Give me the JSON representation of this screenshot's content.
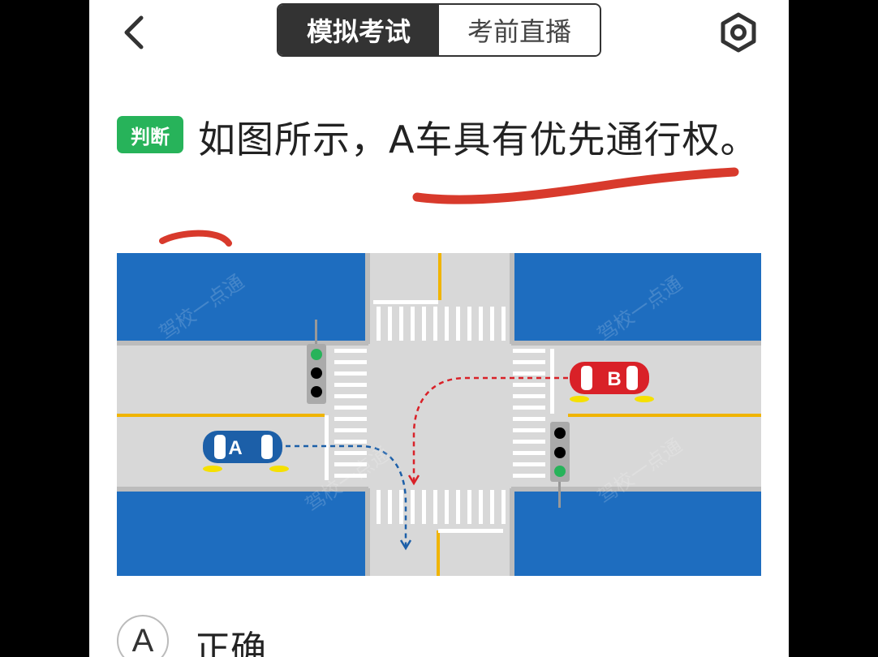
{
  "header": {
    "tabs": [
      {
        "label": "模拟考试",
        "active": true
      },
      {
        "label": "考前直播",
        "active": false
      }
    ],
    "back_icon": "chevron-left-icon",
    "settings_icon": "hexagon-settings-icon"
  },
  "question": {
    "type_badge": "判断",
    "text": "如图所示，A车具有优先通行权。",
    "badge_color": "#27b35a",
    "annotation_color": "#d83a2c"
  },
  "diagram": {
    "water_color": "#1e6dbf",
    "road_color": "#d8d8d8",
    "car_a_label": "A",
    "car_b_label": "B",
    "car_a_color": "#1c5fa8",
    "car_b_color": "#d92128",
    "watermark": "驾校一点通"
  },
  "options": [
    {
      "letter": "A",
      "text": "正确"
    }
  ]
}
